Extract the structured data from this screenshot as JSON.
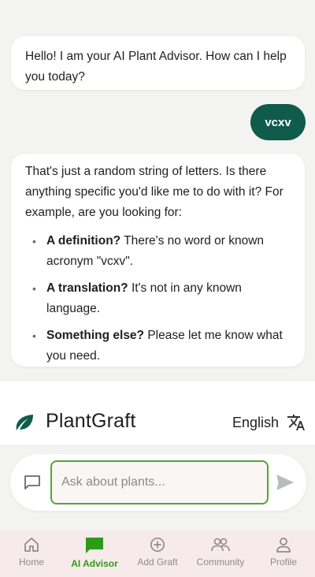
{
  "messages": [
    {
      "role": "ai",
      "text": "Hello! I am your AI Plant Advisor. How can I help you today?"
    },
    {
      "role": "user",
      "text": "vcxv"
    },
    {
      "role": "ai",
      "intro": "That's just a random string of letters.  Is there anything specific you'd like me to do with it?  For example, are you looking for:",
      "bullets": [
        {
          "bold": "A definition?",
          "text": "  There's no word or known acronym \"vcxv\"."
        },
        {
          "bold": "A translation?",
          "text": "  It's not in any known language."
        },
        {
          "bold": "Something else?",
          "text": "  Please let me know what you need."
        }
      ]
    }
  ],
  "brand": {
    "name": "PlantGraft",
    "logo_icon": "leaf-icon",
    "accent": "#0f5b4c"
  },
  "language": {
    "label": "English",
    "icon": "translate-icon"
  },
  "input": {
    "placeholder": "Ask about plants...",
    "value": "",
    "border_color": "#58a23a"
  },
  "nav": [
    {
      "label": "Home",
      "icon": "home-icon",
      "active": false
    },
    {
      "label": "AI Advisor",
      "icon": "chat-icon",
      "active": true
    },
    {
      "label": "Add Graft",
      "icon": "add-circle-icon",
      "active": false
    },
    {
      "label": "Community",
      "icon": "people-icon",
      "active": false
    },
    {
      "label": "Profile",
      "icon": "person-icon",
      "active": false
    }
  ],
  "colors": {
    "nav_active": "#2e9a1a",
    "nav_background": "#f7eaea",
    "user_bubble": "#0f5b4c"
  }
}
